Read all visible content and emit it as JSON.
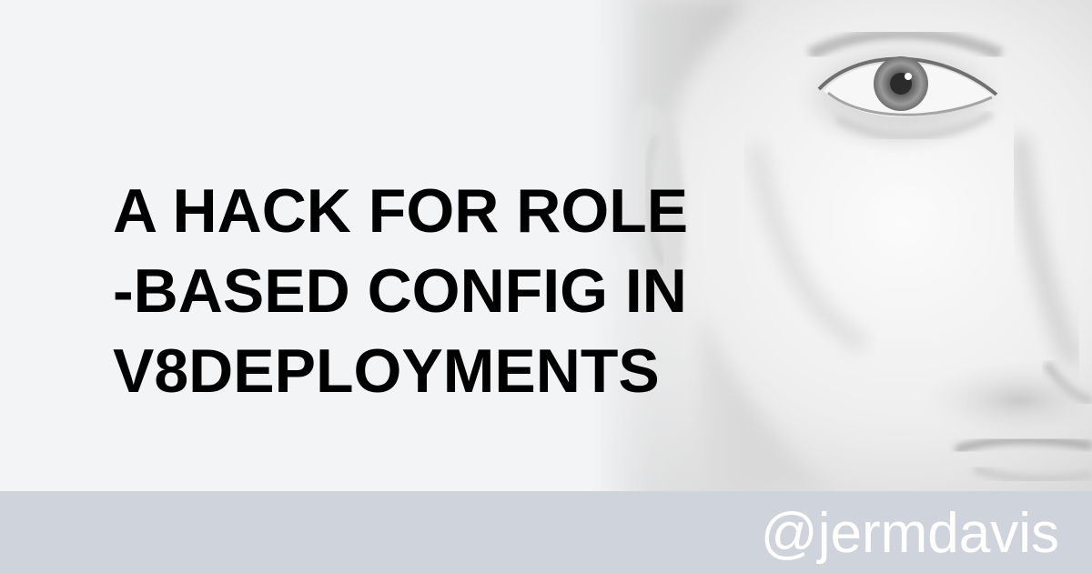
{
  "title": {
    "lines": [
      "A HACK FOR ROLE",
      "-BASED CONFIG IN",
      "V8DEPLOYMENTS"
    ]
  },
  "footer": {
    "handle": "@jermdavis"
  },
  "colors": {
    "background": "#f3f4f6",
    "footer": "#cfd3dc",
    "title_text": "#000000",
    "handle_text": "#ffffff"
  },
  "photo": {
    "subject": "face-closeup-image"
  }
}
